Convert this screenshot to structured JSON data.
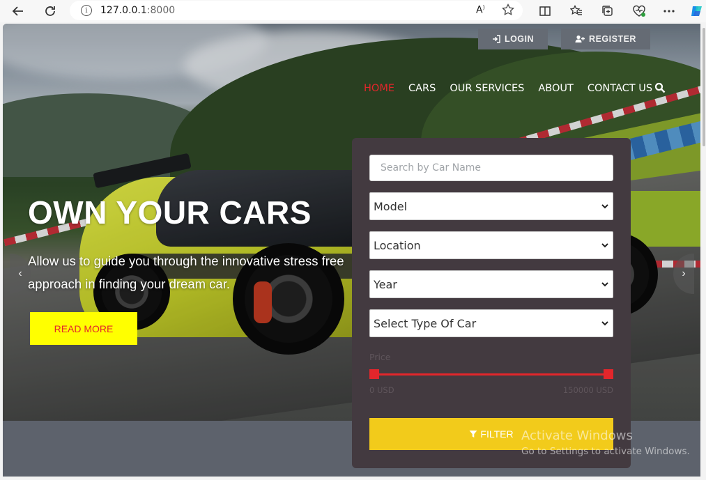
{
  "browser": {
    "url_host": "127.0.0.1",
    "url_port": ":8000",
    "read_aloud_label": "A",
    "info_label": "i"
  },
  "header": {
    "login_label": "LOGIN",
    "register_label": "REGISTER",
    "nav": [
      "HOME",
      "CARS",
      "OUR SERVICES",
      "ABOUT",
      "CONTACT US"
    ],
    "active_nav": "HOME"
  },
  "hero": {
    "title": "OWN YOUR CARS",
    "subtitle": "Allow us to guide you through the innovative stress free approach in finding your dream car.",
    "read_more_label": "READ MORE",
    "prev_arrow": "‹",
    "next_arrow": "›"
  },
  "filter": {
    "search_placeholder": "Search by Car Name",
    "model_value": "Model",
    "location_value": "Location",
    "year_value": "Year",
    "type_value": "Select Type Of Car",
    "price_label": "Price",
    "price_min": "0 USD",
    "price_max": "150000 USD",
    "filter_label": "FILTER"
  },
  "watermark": {
    "line1": "Activate Windows",
    "line2": "Go to Settings to activate Windows."
  },
  "colors": {
    "accent_red": "#e3262b",
    "read_more_bg": "#ffff00",
    "filter_btn_bg": "#f2cb1b",
    "panel_bg": "#433a40"
  }
}
